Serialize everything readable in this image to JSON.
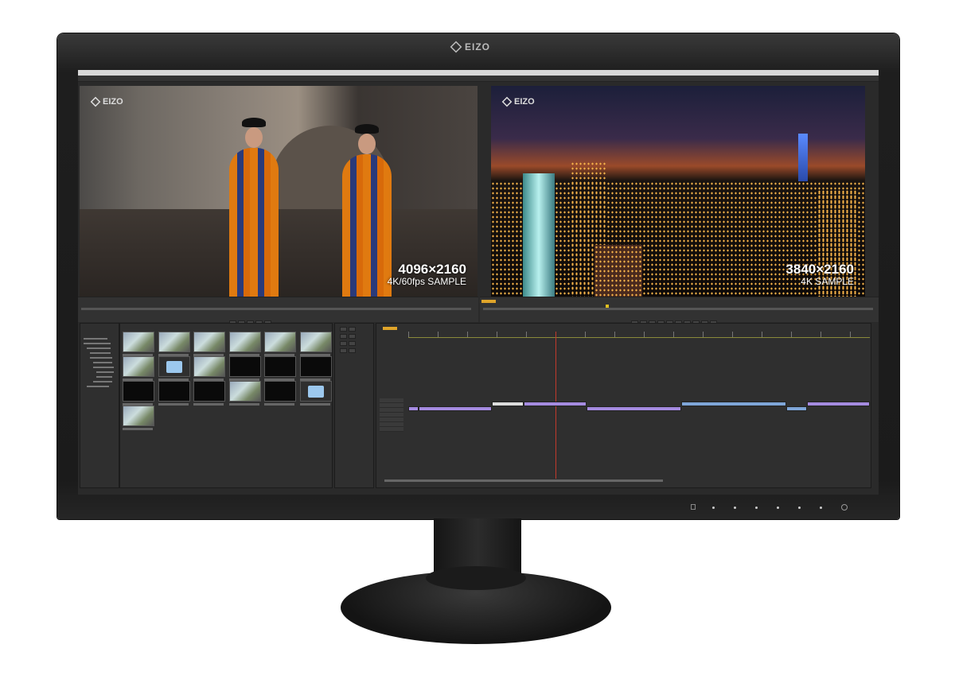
{
  "monitor": {
    "brand": "EIZO"
  },
  "viewers": [
    {
      "name": "source",
      "watermark": "EIZO",
      "resolution": "4096×2160",
      "caption": "4K/60fps SAMPLE"
    },
    {
      "name": "program",
      "watermark": "EIZO",
      "resolution": "3840×2160",
      "caption": "4K SAMPLE"
    }
  ],
  "media_browser": {
    "thumbnails": [
      "image",
      "image",
      "image",
      "image",
      "image",
      "image",
      "image",
      "folder",
      "image",
      "black",
      "black",
      "black",
      "black",
      "black",
      "black",
      "image",
      "black",
      "folder",
      "image"
    ]
  },
  "timeline": {
    "clips": [
      {
        "track": "V1",
        "color": "purple",
        "start": 0,
        "end": 1
      },
      {
        "track": "V1",
        "color": "purple",
        "start": 1,
        "end": 8
      },
      {
        "track": "V2",
        "color": "white",
        "start": 8,
        "end": 11
      },
      {
        "track": "V2",
        "color": "purple",
        "start": 11,
        "end": 17
      },
      {
        "track": "V1",
        "color": "purple",
        "start": 17,
        "end": 26
      },
      {
        "track": "V2",
        "color": "blue",
        "start": 26,
        "end": 36
      },
      {
        "track": "V1",
        "color": "blue",
        "start": 36,
        "end": 38
      },
      {
        "track": "V2",
        "color": "purple",
        "start": 38,
        "end": 44
      }
    ],
    "duration": 44,
    "playhead": 14
  },
  "colors": {
    "accent": "#e0a52a",
    "clip_purple": "#a58be0",
    "clip_blue": "#7fa6d8",
    "playhead": "#c0392b"
  }
}
